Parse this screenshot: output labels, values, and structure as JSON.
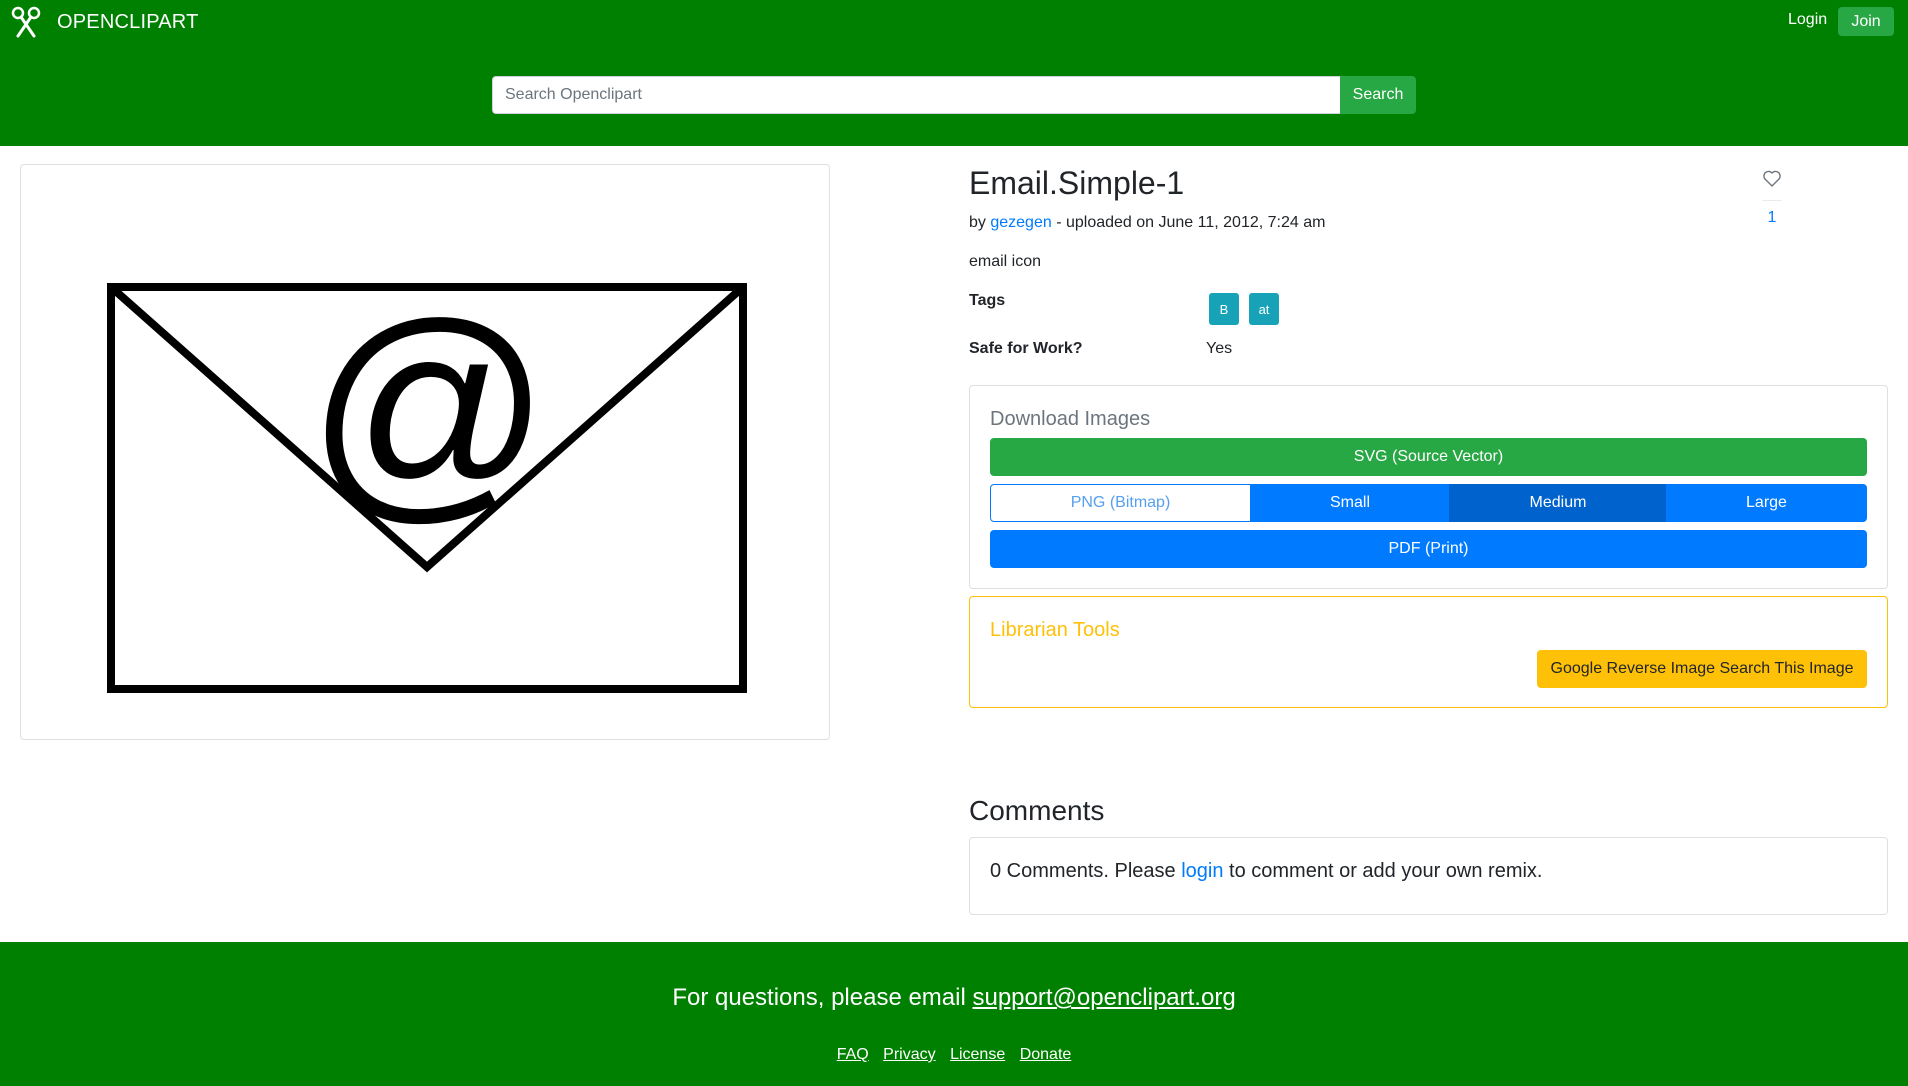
{
  "header": {
    "brand": "OPENCLIPART",
    "login_label": "Login",
    "join_label": "Join",
    "search": {
      "placeholder": "Search Openclipart",
      "button_label": "Search"
    },
    "background_color": "#008000"
  },
  "clipart": {
    "name": "Email.Simple-1",
    "author_prefix": "by",
    "author": "gezegen",
    "uploaded_text": "- uploaded on June 11, 2012, 7:24 am",
    "description": "email icon",
    "favorites_count": "1",
    "image_glyph": "@"
  },
  "details": {
    "tags_label": "Tags",
    "tags": [
      "B",
      "at"
    ],
    "sfw_label": "Safe for Work?",
    "sfw_value": "Yes"
  },
  "download": {
    "title": "Download Images",
    "svg_label": "SVG (Source Vector)",
    "png_label": "PNG (Bitmap)",
    "png_sizes": [
      "Small",
      "Medium",
      "Large"
    ],
    "pdf_label": "PDF (Print)"
  },
  "librarian": {
    "title": "Librarian Tools",
    "google_label": "Google Reverse Image Search This Image"
  },
  "comments": {
    "title": "Comments",
    "text_before": "0 Comments. Please ",
    "login_link": "login",
    "text_after": " to comment or add your own remix."
  },
  "footer": {
    "question_text": "For questions, please email ",
    "email": "support@openclipart.org",
    "links": [
      "FAQ",
      "Privacy",
      "License",
      "Donate"
    ]
  },
  "colors": {
    "brand_green": "#008000",
    "success_green": "#28a745",
    "primary_blue": "#007bff",
    "info_teal": "#17a2b8",
    "warning_yellow": "#ffc107"
  },
  "icons": {
    "brand": "scissors-icon",
    "favorite": "heart-icon"
  }
}
